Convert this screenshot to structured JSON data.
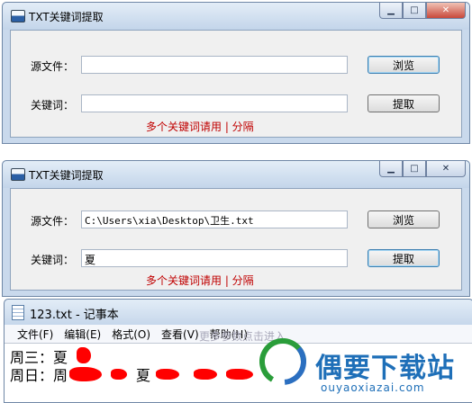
{
  "dialog1": {
    "title": "TXT关键词提取",
    "source_label": "源文件：",
    "source_value": "",
    "keyword_label": "关键词：",
    "keyword_value": "",
    "browse_label": "浏览",
    "extract_label": "提取",
    "hint": "多个关键词请用 | 分隔"
  },
  "dialog2": {
    "title": "TXT关键词提取",
    "source_label": "源文件：",
    "source_value": "C:\\Users\\xia\\Desktop\\卫生.txt",
    "keyword_label": "关键词：",
    "keyword_value": "夏",
    "browse_label": "浏览",
    "extract_label": "提取",
    "hint": "多个关键词请用 | 分隔"
  },
  "notepad": {
    "title": "123.txt - 记事本",
    "menu": [
      "文件(F)",
      "编辑(E)",
      "格式(O)",
      "查看(V)",
      "帮助(H)"
    ],
    "ghost_text": "更多参数点击进入",
    "lines": [
      "周三：夏",
      "周日：周",
      "夏"
    ]
  },
  "watermark": {
    "brand": "偶要下载站",
    "url": "ouyaoxiazai.com"
  },
  "colors": {
    "hint": "#c00000",
    "scribble": "#ff0000",
    "brand": "#1e6fb8"
  },
  "icons": {
    "app": "window-app-icon",
    "notepad": "notepad-icon",
    "minimize": "minimize-icon",
    "maximize": "maximize-icon",
    "close": "close-icon"
  }
}
